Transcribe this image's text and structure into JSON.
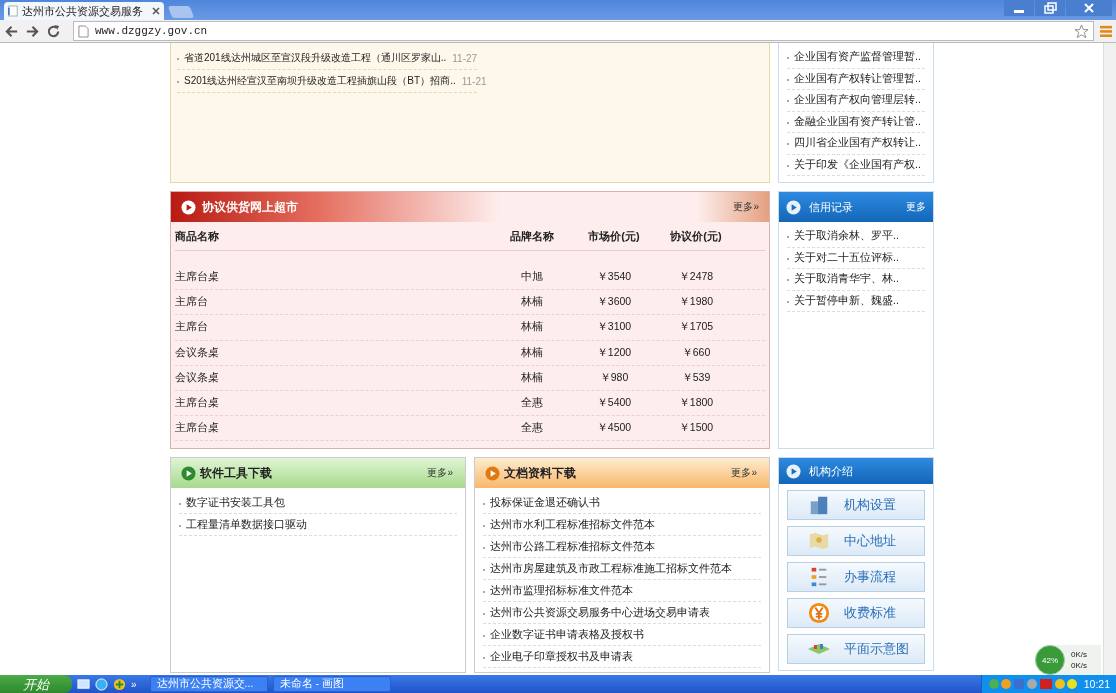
{
  "browser": {
    "tab_title": "达州市公共资源交易服务",
    "url": "www.dzggzy.gov.cn"
  },
  "notices": [
    {
      "title": "省道201线达州城区至宣汉段升级改造工程（通川区罗家山..",
      "date": "11-27"
    },
    {
      "title": "S201线达州经宣汉至南坝升级改造工程插旗山段（BT）招商..",
      "date": "11-21"
    }
  ],
  "policy_list": [
    "企业国有资产监督管理暂..",
    "企业国有产权转让管理暂..",
    "企业国有产权向管理层转..",
    "金融企业国有资产转让管..",
    "四川省企业国有产权转让..",
    "关于印发《企业国有产权.."
  ],
  "supermarket": {
    "title": "协议供货网上超市",
    "more": "更多»",
    "columns": [
      "商品名称",
      "品牌名称",
      "市场价(元)",
      "协议价(元)"
    ],
    "rows": [
      [
        "主席台桌",
        "中旭",
        "￥3540",
        "￥2478"
      ],
      [
        "主席台",
        "林楠",
        "￥3600",
        "￥1980"
      ],
      [
        "主席台",
        "林楠",
        "￥3100",
        "￥1705"
      ],
      [
        "会议条桌",
        "林楠",
        "￥1200",
        "￥660"
      ],
      [
        "会议条桌",
        "林楠",
        "￥980",
        "￥539"
      ],
      [
        "主席台桌",
        "全惠",
        "￥5400",
        "￥1800"
      ],
      [
        "主席台桌",
        "全惠",
        "￥4500",
        "￥1500"
      ]
    ]
  },
  "credit": {
    "title": "信用记录",
    "more": "更多",
    "items": [
      "关于取消余林、罗平..",
      "关于对二十五位评标..",
      "关于取消青华宇、林..",
      "关于暂停申新、魏盛.."
    ]
  },
  "software": {
    "title": "软件工具下载",
    "more": "更多»",
    "items": [
      "数字证书安装工具包",
      "工程量清单数据接口驱动"
    ]
  },
  "documents": {
    "title": "文档资料下载",
    "more": "更多»",
    "items": [
      "投标保证金退还确认书",
      "达州市水利工程标准招标文件范本",
      "达州市公路工程标准招标文件范本",
      "达州市房屋建筑及市政工程标准施工招标文件范本",
      "达州市监理招标标准文件范本",
      "达州市公共资源交易服务中心进场交易申请表",
      "企业数字证书申请表格及授权书",
      "企业电子印章授权书及申请表"
    ]
  },
  "about": {
    "title": "机构介绍",
    "buttons": [
      {
        "label": "机构设置",
        "kind": "building"
      },
      {
        "label": "中心地址",
        "kind": "map"
      },
      {
        "label": "办事流程",
        "kind": "flow"
      },
      {
        "label": "收费标准",
        "kind": "yen"
      },
      {
        "label": "平面示意图",
        "kind": "plan"
      }
    ]
  },
  "net_monitor": {
    "percent": "42%",
    "up": "0K/s",
    "down": "0K/s"
  },
  "taskbar": {
    "start": "开始",
    "more": "»",
    "tasks": [
      "达州市公共资源交...",
      "未命名 - 画图"
    ],
    "clock": "10:21"
  }
}
